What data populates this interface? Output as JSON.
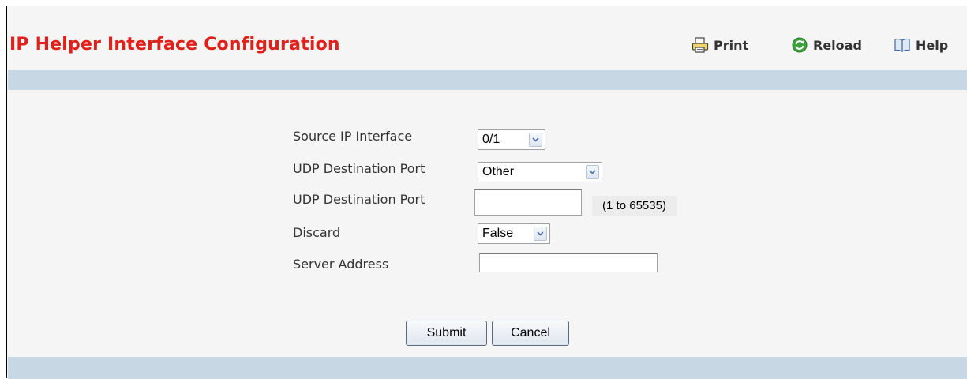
{
  "header": {
    "title": "IP Helper Interface Configuration"
  },
  "toolbar": {
    "print_label": "Print",
    "reload_label": "Reload",
    "help_label": "Help"
  },
  "form": {
    "source_ip_interface": {
      "label": "Source IP Interface",
      "value": "0/1"
    },
    "udp_dest_port_select": {
      "label": "UDP Destination Port",
      "value": "Other"
    },
    "udp_dest_port_input": {
      "label": "UDP Destination Port",
      "value": "",
      "hint": "(1 to 65535)"
    },
    "discard": {
      "label": "Discard",
      "value": "False"
    },
    "server_address": {
      "label": "Server Address",
      "value": ""
    }
  },
  "actions": {
    "submit_label": "Submit",
    "cancel_label": "Cancel"
  },
  "colors": {
    "title": "#e0201a",
    "band": "#c7d7e3",
    "background": "#f5f5f5"
  }
}
